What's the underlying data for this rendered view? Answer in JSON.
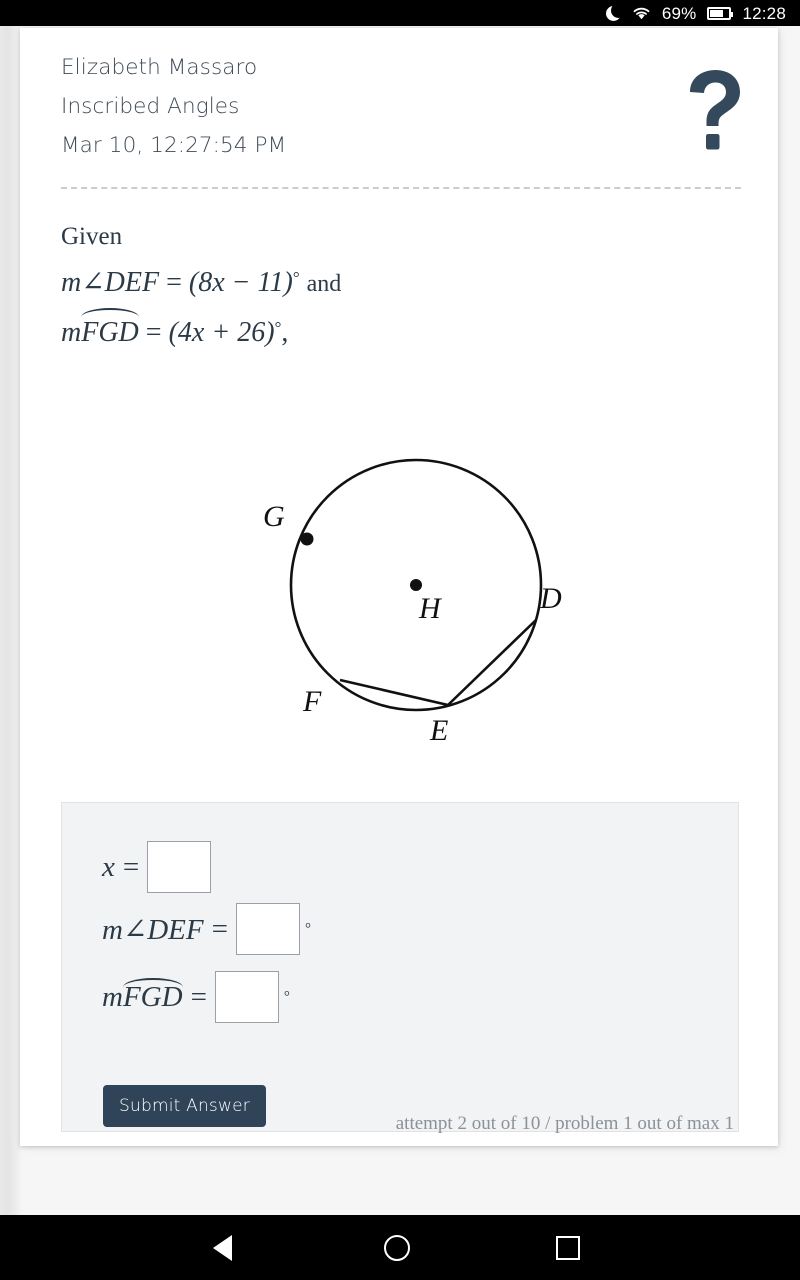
{
  "statusbar": {
    "battery_percent": "69%",
    "clock": "12:28",
    "icons": [
      "moon-icon",
      "wifi-icon",
      "battery-icon"
    ]
  },
  "header": {
    "student_name": "Elizabeth Massaro",
    "assignment_title": "Inscribed Angles",
    "timestamp": "Mar 10, 12:27:54 PM",
    "help_icon": "question-mark-icon",
    "help_icon_color": "#344a5c"
  },
  "problem": {
    "given_label": "Given",
    "line1": {
      "lhs": "m∠DEF",
      "eq": "=",
      "rhs": "(8x − 11)",
      "degree": "°",
      "conjunction": "and"
    },
    "line2": {
      "prefix": "m",
      "arc": "FGD",
      "eq": "=",
      "rhs": "(4x + 26)",
      "degree": "°",
      "trailing": ","
    }
  },
  "figure": {
    "description": "circle-with-inscribed-angle-diagram",
    "center_label": "H",
    "point_labels": [
      "G",
      "D",
      "E",
      "F"
    ],
    "chords": [
      "DE",
      "EF"
    ]
  },
  "answers": {
    "row1": {
      "label": "x",
      "eq": "=",
      "value": "",
      "placeholder": "",
      "degree": ""
    },
    "row2": {
      "label": "m∠DEF",
      "eq": "=",
      "value": "",
      "placeholder": "",
      "degree": "°"
    },
    "row3": {
      "label_prefix": "m",
      "label_arc": "FGD",
      "eq": "=",
      "value": "",
      "placeholder": "",
      "degree": "°"
    },
    "submit_label": "Submit Answer",
    "submit_color": "#2f4459",
    "attempt_status": "attempt 2 out of 10 / problem 1 out of max 1"
  },
  "navbar": {
    "back": "back-icon",
    "home": "home-icon",
    "recents": "recents-icon"
  }
}
